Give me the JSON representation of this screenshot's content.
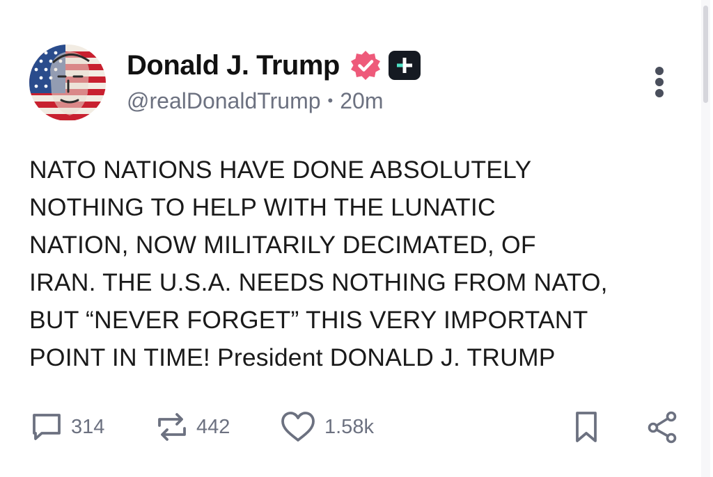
{
  "post": {
    "author_name": "Donald J. Trump",
    "handle": "@realDonaldTrump",
    "separator": "•",
    "time_ago": "20m",
    "text": "NATO NATIONS HAVE DONE ABSOLUTELY\nNOTHING TO HELP WITH THE LUNATIC\nNATION, NOW MILITARILY DECIMATED, OF\nIRAN. THE U.S.A. NEEDS NOTHING FROM NATO,\nBUT “NEVER FORGET” THIS VERY IMPORTANT\nPOINT IN TIME! President DONALD J. TRUMP"
  },
  "actions": {
    "replies": "314",
    "reposts": "442",
    "likes": "1.58k"
  },
  "icons": [
    "verified-badge-icon",
    "plus-badge-icon",
    "more-options-icon",
    "reply-icon",
    "repost-icon",
    "like-icon",
    "bookmark-icon",
    "share-icon"
  ],
  "colors": {
    "verified_badge": "#ee5a7a",
    "plus_badge_bg": "#151a22",
    "plus_badge_accent": "#4ee0c4",
    "muted_text": "#6c7180",
    "icon_gray": "#6c7180"
  }
}
